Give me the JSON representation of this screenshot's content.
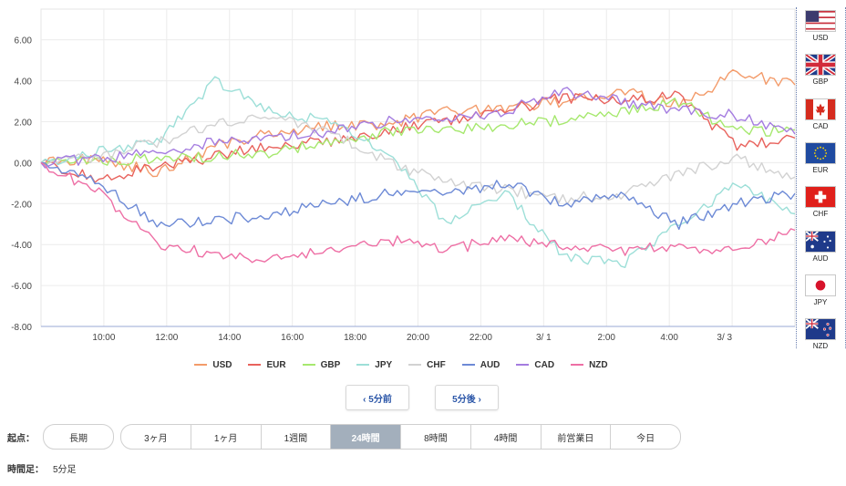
{
  "chart_data": {
    "type": "line",
    "y_ticks": [
      "6.00",
      "4.00",
      "2.00",
      "0.00",
      "-2.00",
      "-4.00",
      "-6.00",
      "-8.00"
    ],
    "ylim": [
      -8,
      7.5
    ],
    "x_ticks": [
      "10:00",
      "12:00",
      "14:00",
      "16:00",
      "18:00",
      "20:00",
      "22:00",
      "3/ 1",
      "2:00",
      "4:00",
      "3/ 3"
    ],
    "x": [
      0,
      2,
      4,
      6,
      8,
      10,
      12,
      14,
      16,
      18,
      20,
      22,
      24
    ],
    "xlim": [
      0,
      24
    ],
    "grid": true,
    "legend_position": "bottom",
    "series": [
      {
        "name": "USD",
        "color": "#f39b6a",
        "values": [
          0,
          0.2,
          -0.5,
          0.8,
          1.5,
          1.8,
          1.9,
          2.5,
          2.6,
          3.0,
          3.5,
          2.8,
          4.4,
          3.8
        ]
      },
      {
        "name": "EUR",
        "color": "#e8625c",
        "values": [
          0,
          -0.8,
          -0.2,
          0.3,
          0.9,
          1.0,
          1.6,
          2.0,
          2.5,
          3.2,
          3.0,
          3.3,
          0.8,
          1.2
        ]
      },
      {
        "name": "GBP",
        "color": "#a6e86e",
        "values": [
          0,
          0.1,
          0.2,
          0.3,
          0.5,
          1.0,
          1.5,
          1.6,
          1.8,
          2.1,
          2.5,
          3.0,
          1.5,
          1.6
        ]
      },
      {
        "name": "JPY",
        "color": "#9ddfd8",
        "values": [
          0,
          0.5,
          1.0,
          4.0,
          2.5,
          2.0,
          0.5,
          -3.0,
          -1.5,
          -4.5,
          -5.0,
          -3.0,
          -1.0,
          -2.5
        ]
      },
      {
        "name": "CHF",
        "color": "#d2d2d2",
        "values": [
          0,
          0.3,
          1.0,
          1.9,
          2.2,
          1.5,
          0.0,
          -1.0,
          -1.3,
          -1.8,
          -1.5,
          -0.5,
          0.2,
          -0.7
        ]
      },
      {
        "name": "AUD",
        "color": "#6d8ad6",
        "values": [
          0,
          -1.0,
          -3.0,
          -2.8,
          -2.5,
          -2.0,
          -1.5,
          -1.5,
          -1.0,
          -2.0,
          -1.5,
          -3.0,
          -2.0,
          -1.5
        ]
      },
      {
        "name": "CAD",
        "color": "#a47ce0",
        "values": [
          0,
          0.2,
          0.5,
          1.0,
          1.2,
          1.5,
          2.0,
          2.2,
          2.5,
          3.5,
          3.0,
          2.6,
          2.3,
          1.4
        ]
      },
      {
        "name": "NZD",
        "color": "#ee6fa5",
        "values": [
          0,
          -1.5,
          -4.0,
          -4.5,
          -4.7,
          -4.2,
          -3.8,
          -4.2,
          -3.8,
          -4.0,
          -4.3,
          -4.1,
          -4.3,
          -3.3
        ]
      }
    ]
  },
  "flags": [
    {
      "code": "USD",
      "icon": "us-flag-icon"
    },
    {
      "code": "GBP",
      "icon": "uk-flag-icon"
    },
    {
      "code": "CAD",
      "icon": "canada-flag-icon"
    },
    {
      "code": "EUR",
      "icon": "eu-flag-icon"
    },
    {
      "code": "CHF",
      "icon": "swiss-flag-icon"
    },
    {
      "code": "AUD",
      "icon": "australia-flag-icon"
    },
    {
      "code": "JPY",
      "icon": "japan-flag-icon"
    },
    {
      "code": "NZD",
      "icon": "new-zealand-flag-icon"
    }
  ],
  "nav": {
    "prev": "‹ 5分前",
    "next": "5分後 ›"
  },
  "controls": {
    "start_label": "起点：",
    "period_first": "長期",
    "periods": [
      "3ヶ月",
      "1ヶ月",
      "1週間",
      "24時間",
      "8時間",
      "4時間",
      "前営業日",
      "今日"
    ],
    "active_period": "24時間",
    "interval_label": "時間足：",
    "interval_value": "5分足"
  }
}
